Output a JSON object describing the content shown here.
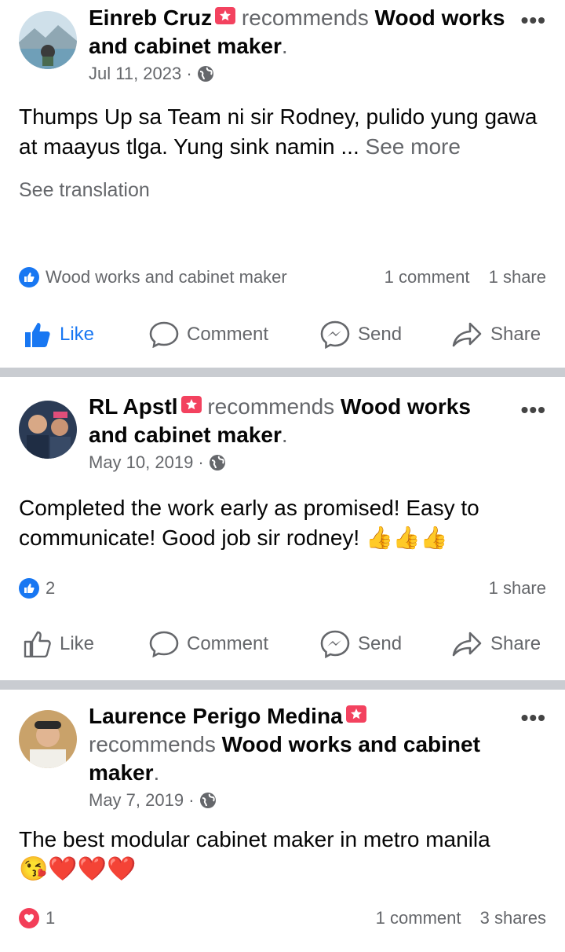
{
  "business_name": "Wood works and cabinet maker",
  "labels": {
    "recommends": "recommends",
    "see_more": "See more",
    "see_translation": "See translation",
    "like": "Like",
    "comment": "Comment",
    "send": "Send",
    "share": "Share",
    "more": "•••"
  },
  "posts": [
    {
      "author": "Einreb Cruz",
      "biz_a": "Wood",
      "biz_b": "works and cabinet maker",
      "period": ".",
      "date": "Jul 11, 2023 ·",
      "body": "Thumps Up sa Team ni sir Rodney, pulido yung gawa at maayus tlga. Yung sink namin ...",
      "reaction_label": "Wood works and cabinet maker",
      "comments": "1 comment",
      "shares": "1 share",
      "liked": true
    },
    {
      "author": "RL Apstl",
      "biz_a": "Wood works",
      "biz_b": "and cabinet maker",
      "period": ".",
      "date": "May 10, 2019 ·",
      "body": "Completed the work early as promised! Easy to communicate! Good job sir rodney! 👍👍👍",
      "reaction_count": "2",
      "shares": "1 share",
      "liked": false
    },
    {
      "author": "Laurence Perigo Medina",
      "biz": "Wood works and cabinet",
      "biz_c": "maker",
      "period": ".",
      "date": "May 7, 2019 ·",
      "body_1": "The best modular cabinet maker in metro manila",
      "body_2": "😘❤️❤️❤️",
      "reaction_count": "1",
      "comments": "1 comment",
      "shares": "3 shares"
    }
  ],
  "colors": {
    "accent": "#1877f2",
    "secondary_text": "#65676b",
    "badge": "#f3425f",
    "divider": "#c9ccd1",
    "love": "#f33e58"
  }
}
